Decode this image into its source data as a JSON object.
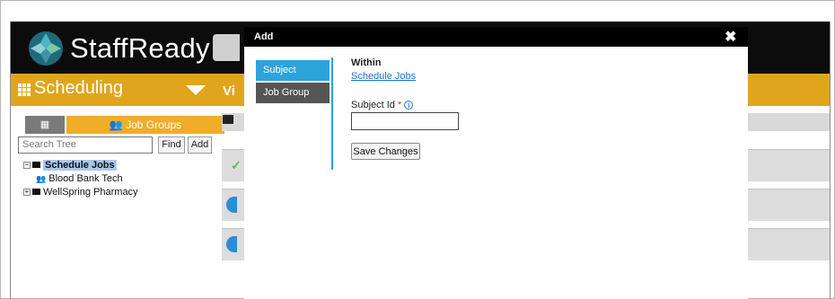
{
  "app": {
    "logo_text": "StaffReady",
    "nav_title": "Scheduling",
    "nav_partial_label": "Vi"
  },
  "tree_panel": {
    "org_tab_label": "",
    "job_groups_tab_label": "Job Groups",
    "search_placeholder": "Search Tree",
    "find_label": "Find",
    "add_label": "Add",
    "nodes": [
      {
        "label": "Schedule Jobs",
        "selected": true,
        "icon": "folder-icon"
      },
      {
        "label": "Blood Bank Tech",
        "icon": "job-group-icon"
      },
      {
        "label": "WellSpring Pharmacy",
        "icon": "folder-icon"
      }
    ]
  },
  "modal": {
    "title": "Add",
    "close_symbol": "✖",
    "tabs": [
      {
        "label": "Subject",
        "active": true
      },
      {
        "label": "Job Group",
        "active": false
      }
    ],
    "within_label": "Within",
    "within_value": "Schedule Jobs",
    "subject_id_label": "Subject Id",
    "required_marker": "*",
    "subject_id_value": "",
    "save_label": "Save Changes"
  },
  "colors": {
    "topbar": "#0c0c0c",
    "navbar": "#e0a51c",
    "accent": "#2da3dc",
    "modal_header": "#000000",
    "inactive_tab": "#555555",
    "link": "#1a73c8",
    "required": "#e12b2b"
  }
}
